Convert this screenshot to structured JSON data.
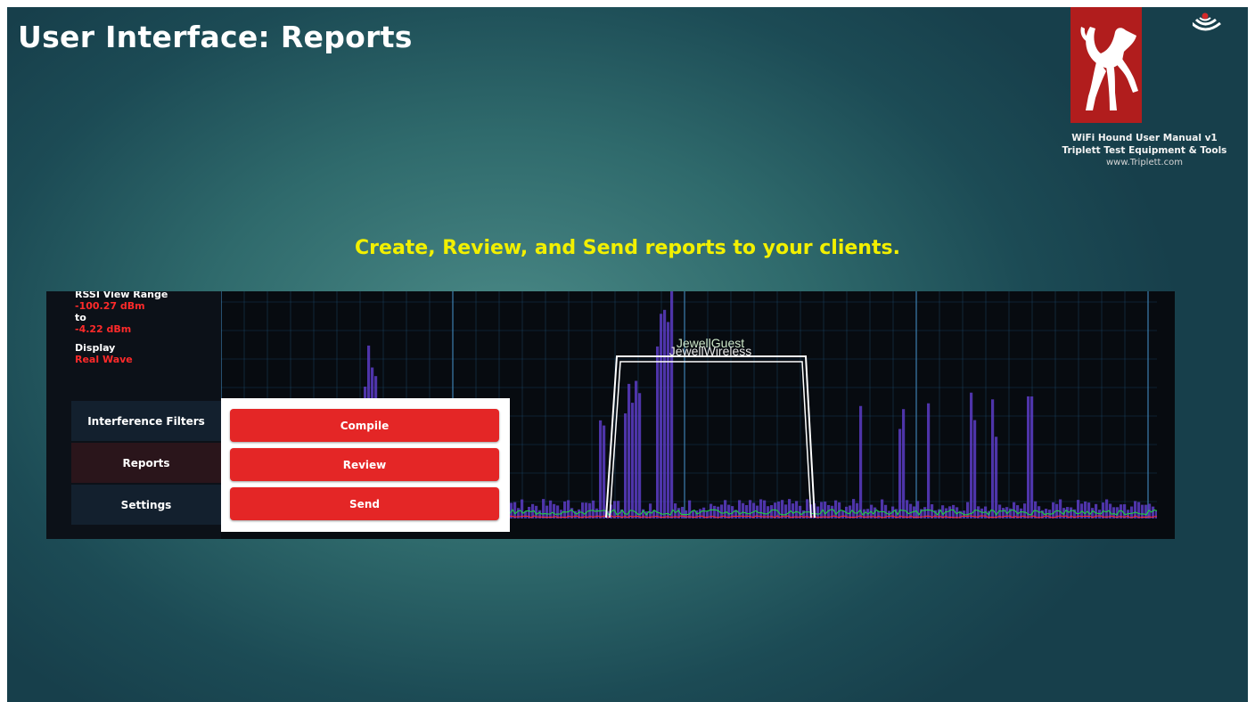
{
  "slide": {
    "title": "User Interface: Reports",
    "subtitle": "Create, Review, and Send reports to your clients.",
    "brand": {
      "line1": "WiFi Hound User Manual v1",
      "line2": "Triplett Test Equipment & Tools",
      "url": "www.Triplett.com",
      "logo_color": "#b11d1d"
    },
    "accent_color": "#f2f000"
  },
  "app": {
    "side_info": {
      "rssi_label": "RSSI View Range",
      "rssi_min": "-100.27 dBm",
      "to_label": "to",
      "rssi_max": "-4.22 dBm",
      "display_label": "Display",
      "display_value": "Real Wave"
    },
    "menu": [
      {
        "label": "Interference Filters"
      },
      {
        "label": "Reports"
      },
      {
        "label": "Settings"
      }
    ],
    "report_actions": [
      {
        "label": "Compile"
      },
      {
        "label": "Review"
      },
      {
        "label": "Send"
      }
    ],
    "spectrum": {
      "network_labels": [
        "JewellGuest",
        "JewellWireless"
      ],
      "colors": {
        "bars": "#5b3cc4",
        "trace_green": "#1fdc3c",
        "trace_red": "#ff2a2a",
        "grid": "#1d4f73",
        "channel_box": "#ffffff"
      }
    }
  }
}
